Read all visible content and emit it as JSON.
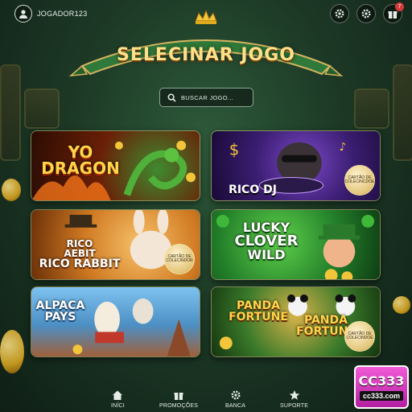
{
  "user": {
    "username": "JOGADOR123",
    "notification_count": "7"
  },
  "header": {
    "title": "SELECINAR JOGO"
  },
  "search": {
    "placeholder": "BUSCAR JOGO..."
  },
  "games": [
    {
      "title_lines": [
        "YO",
        "DRAGON"
      ],
      "badge": ""
    },
    {
      "title_lines": [
        "RICO DJ"
      ],
      "badge": "CARTÃO DE COLECINCDOE"
    },
    {
      "title_lines": [
        "RICO",
        "AEBIT",
        "RICO RABBIT"
      ],
      "badge": "CARTÃO DE COLECINDOR"
    },
    {
      "title_lines": [
        "LUCKY",
        "CLOVER",
        "WILD"
      ],
      "badge": ""
    },
    {
      "title_lines": [
        "ALPACA",
        "PAYS"
      ],
      "badge": ""
    },
    {
      "title_lines": [
        "PANDA",
        "FORTUNE",
        "PANDA",
        "FORTUNE"
      ],
      "badge": "CARTÃO DE COLECINDOE"
    }
  ],
  "nav": [
    {
      "label": "INÍCI",
      "icon": "home-icon"
    },
    {
      "label": "PROMOÇÕES",
      "icon": "gift-icon"
    },
    {
      "label": "BANCA",
      "icon": "gear-icon"
    },
    {
      "label": "SUPORTE",
      "icon": "star-icon"
    }
  ],
  "watermark": {
    "brand": "CC333",
    "site": "cc333.com"
  },
  "colors": {
    "accent_gold": "#ffe08a",
    "banner_green": "#2f7a3a",
    "notif_red": "#d63b3b"
  }
}
